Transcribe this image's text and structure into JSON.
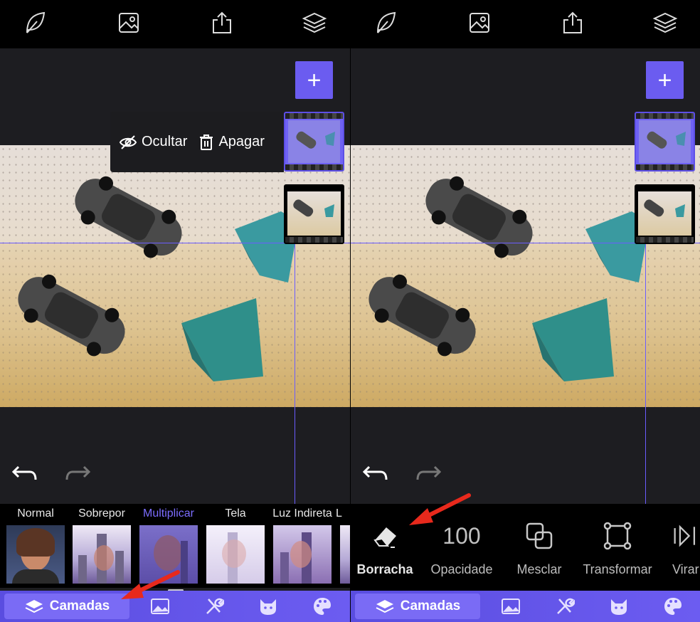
{
  "left": {
    "layer_menu": {
      "hide_label": "Ocultar",
      "delete_label": "Apagar"
    },
    "add_label": "+",
    "blend_modes": [
      {
        "label": "Normal",
        "active": false
      },
      {
        "label": "Sobrepor",
        "active": false
      },
      {
        "label": "Multiplicar",
        "active": true
      },
      {
        "label": "Tela",
        "active": false
      },
      {
        "label": "Luz Indireta",
        "active": false
      },
      {
        "label": "L",
        "active": false
      }
    ],
    "tabbar": {
      "active_label": "Camadas"
    }
  },
  "right": {
    "add_label": "+",
    "tools": [
      {
        "label": "Borracha",
        "active": true
      },
      {
        "label": "Opacidade",
        "value": "100",
        "active": false
      },
      {
        "label": "Mesclar",
        "active": false
      },
      {
        "label": "Transformar",
        "active": false
      },
      {
        "label": "Virar",
        "active": false
      }
    ],
    "tabbar": {
      "active_label": "Camadas"
    }
  },
  "icons": {
    "top": [
      "leaf-icon",
      "image-icon",
      "share-icon",
      "layers-icon"
    ],
    "tabs": [
      "layers-icon",
      "image-icon",
      "tools-icon",
      "cat-mask-icon",
      "palette-icon"
    ]
  },
  "colors": {
    "accent": "#6b5cf0",
    "active_text": "#7c6dff",
    "guide": "#6a5cff",
    "arrow": "#e8291c"
  }
}
